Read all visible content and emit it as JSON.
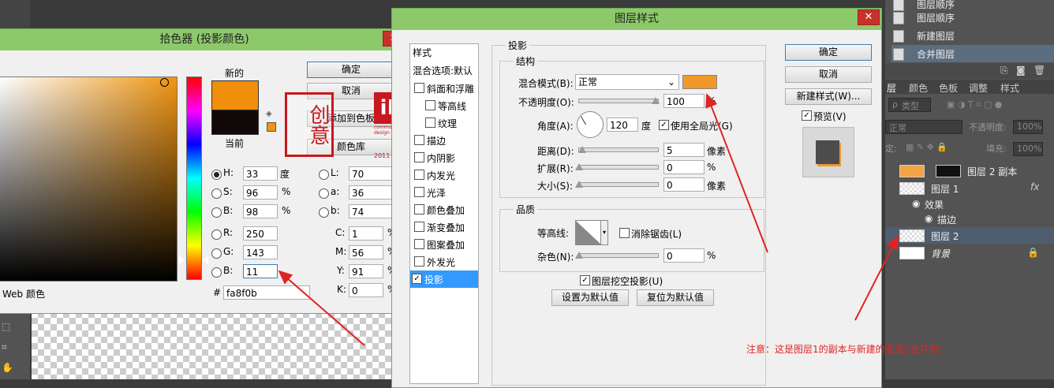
{
  "history": [
    "图层顺序",
    "图层顺序",
    "新建图层",
    "合并图层"
  ],
  "panel_tabs": [
    "层",
    "颜色",
    "色板",
    "调整",
    "样式"
  ],
  "layers_toolbar": {
    "kind": "类型",
    "blend": "正常",
    "opacity_label": "不透明度:",
    "opacity": "100%",
    "lock_label": "定:",
    "fill_label": "填充:",
    "fill": "100%"
  },
  "layers": [
    {
      "name": "图层 2 副本",
      "fx": ""
    },
    {
      "name": "图层 1",
      "fx": "fx"
    },
    {
      "name": "效果",
      "fx": ""
    },
    {
      "name": "描边",
      "fx": ""
    },
    {
      "name": "图层 2",
      "fx": ""
    },
    {
      "name": "背景",
      "fx": ""
    }
  ],
  "color_picker": {
    "title": "拾色器 (投影颜色)",
    "new_label": "新的",
    "current_label": "当前",
    "ok": "确定",
    "cancel": "取消",
    "add_swatch": "添加到色板",
    "library": "颜色库",
    "web_only": "Web 颜色",
    "new_color": "#f08f0b",
    "current_color": "#110808",
    "fields": {
      "H": "33",
      "S": "96",
      "B": "98",
      "R": "250",
      "G": "143",
      "B2": "11",
      "L": "70",
      "a": "36",
      "b": "74",
      "C": "1",
      "M": "56",
      "Y": "91",
      "K": "0"
    },
    "units": {
      "deg": "度",
      "pct": "%"
    },
    "hex_label": "#",
    "hex": "fa8f0b"
  },
  "layer_style": {
    "title": "图层样式",
    "styles_header": "样式",
    "blend_options": "混合选项:默认",
    "items": [
      "斜面和浮雕",
      "等高线",
      "纹理",
      "描边",
      "内阴影",
      "内发光",
      "光泽",
      "颜色叠加",
      "渐变叠加",
      "图案叠加",
      "外发光",
      "投影"
    ],
    "section": "投影",
    "structure": "结构",
    "blend_mode_label": "混合模式(B):",
    "blend_mode": "正常",
    "shadow_color": "#f0982a",
    "opacity_label": "不透明度(O):",
    "opacity": "100",
    "angle_label": "角度(A):",
    "angle": "120",
    "angle_unit": "度",
    "global_light": "使用全局光(G)",
    "distance_label": "距离(D):",
    "distance": "5",
    "spread_label": "扩展(R):",
    "spread": "0",
    "size_label": "大小(S):",
    "size": "0",
    "px_unit": "像素",
    "pct_unit": "%",
    "quality": "品质",
    "contour_label": "等高线:",
    "antialias": "消除锯齿(L)",
    "noise_label": "杂色(N):",
    "noise": "0",
    "knockout": "图层挖空投影(U)",
    "set_default": "设置为默认值",
    "reset_default": "复位为默认值",
    "ok": "确定",
    "cancel": "取消",
    "new_style": "新建样式(W)...",
    "preview": "预览(V)"
  },
  "stamp": {
    "text": "创意",
    "award": "iF",
    "award_sub": "communication design award",
    "year": "2011"
  },
  "note": "注意：这是图层1的副本与新建的图层2合并的!",
  "close_glyph": "✕"
}
